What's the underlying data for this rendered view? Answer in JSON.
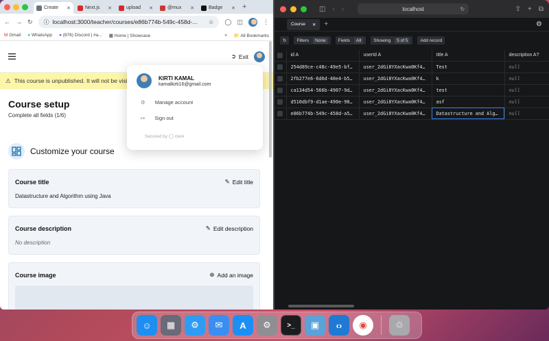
{
  "chrome": {
    "tabs": [
      {
        "label": "Create",
        "favicon_color": "#6b7280",
        "active": true
      },
      {
        "label": "Next.js",
        "favicon_color": "#d62a2a",
        "active": false
      },
      {
        "label": "upload",
        "favicon_color": "#d62a2a",
        "active": false
      },
      {
        "label": "@mux",
        "favicon_color": "#cb3837",
        "active": false
      },
      {
        "label": "Badge",
        "favicon_color": "#111111",
        "active": false
      }
    ],
    "url": "localhost:3000/teacher/courses/e86b774b-549c-458d-...",
    "bookmarks": [
      "Gmail",
      "WhatsApp",
      "(876) Discord | #a...",
      "Home | Showcase"
    ],
    "all_bookmarks": "All Bookmarks"
  },
  "page": {
    "exit_label": "Exit",
    "banner_text": "This course is unpublished. It will not be visible",
    "setup_title": "Course setup",
    "setup_sub": "Complete all fields (1/6)",
    "customize_title": "Customize your course",
    "title_card": {
      "label": "Course title",
      "action": "Edit title",
      "value": "Datastructure and Algorithm using Java"
    },
    "desc_card": {
      "label": "Course description",
      "action": "Edit description",
      "value": "No description"
    },
    "image_card": {
      "label": "Course image",
      "action": "Add an image"
    }
  },
  "popup": {
    "name": "KIRTI KAMAL",
    "email": "kamalkirti16@gmail.com",
    "manage": "Manage account",
    "signout": "Sign out",
    "secured_by": "Secured by",
    "clerk": "clerk"
  },
  "safari": {
    "url": "localhost"
  },
  "prisma": {
    "tab": "Course",
    "filters": "Filters",
    "filters_val": "None",
    "fields": "Fields",
    "fields_val": "All",
    "showing": "Showing",
    "showing_val": "5 of 5",
    "add_record": "Add record",
    "columns": [
      "id A",
      "userId A",
      "title A",
      "description A?"
    ],
    "rows": [
      [
        "254d89ce-c48c-49e5-bf…",
        "user_2dGi8YXacKwa0Kf4…",
        "Test",
        "null"
      ],
      [
        "2fb277e6-6d6d-40e4-b5…",
        "user_2dGi8YXacKwa0Kf4…",
        "k",
        "null"
      ],
      [
        "ca134d54-566b-4907-9d…",
        "user_2dGi8YXacKwa0Kf4…",
        "test",
        "null"
      ],
      [
        "d510dbf9-d1ae-490e-90…",
        "user_2dGi8YXacKwa0Kf4…",
        "asf",
        "null"
      ],
      [
        "e86b774b-549c-458d-a5…",
        "user_2dGi8YXacKwa0Kf4…",
        "Datastructure and Alg…",
        "null"
      ]
    ]
  },
  "dock": [
    {
      "name": "finder-icon",
      "color": "#1e8ff0"
    },
    {
      "name": "launchpad-icon",
      "color": "#6a6a78"
    },
    {
      "name": "safari-icon",
      "color": "#2f9cf3"
    },
    {
      "name": "mail-icon",
      "color": "#3a8ef0"
    },
    {
      "name": "app-store-icon",
      "color": "#1c8ff5"
    },
    {
      "name": "system-settings-icon",
      "color": "#8e8e93"
    },
    {
      "name": "terminal-icon",
      "color": "#1c1c1e"
    },
    {
      "name": "preview-icon",
      "color": "#5aa3d9"
    },
    {
      "name": "vscode-icon",
      "color": "#1f7ad4"
    },
    {
      "name": "chrome-icon",
      "color": "#ffffff"
    },
    {
      "name": "trash-icon",
      "color": "#a8a8ad"
    }
  ]
}
